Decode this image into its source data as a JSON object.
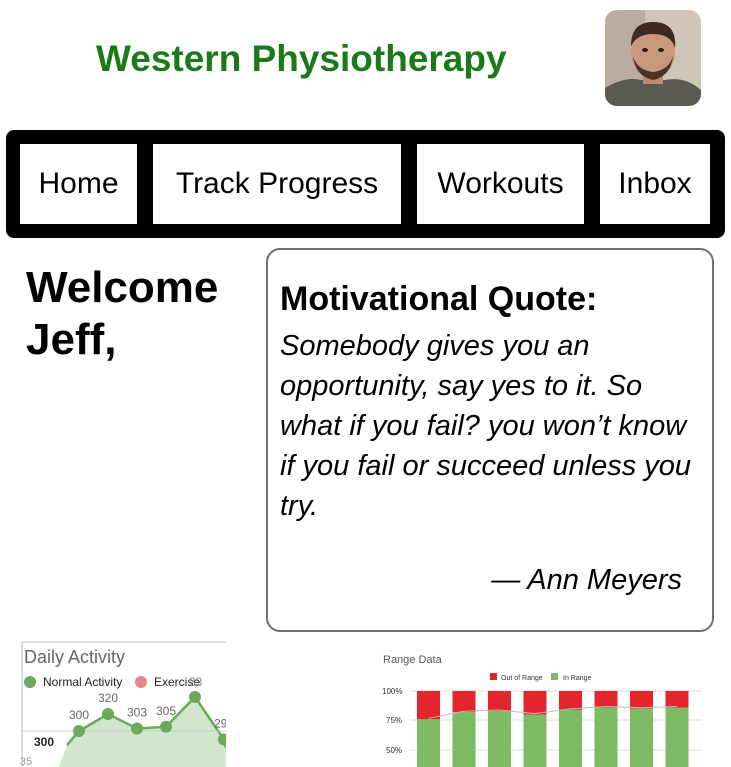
{
  "header": {
    "app_title": "Western Physiotherapy",
    "brand_color": "#1a7a1a"
  },
  "nav": {
    "items": [
      {
        "label": "Home"
      },
      {
        "label": "Track Progress"
      },
      {
        "label": "Workouts"
      },
      {
        "label": "Inbox"
      }
    ]
  },
  "welcome": {
    "line1": "Welcome",
    "line2": "Jeff,"
  },
  "quote": {
    "heading": "Motivational Quote:",
    "text": "Somebody gives you an opportunity, say yes to it. So what if you fail? you won’t know if you fail or succeed unless you try.",
    "author": "— Ann Meyers"
  },
  "chart_data": [
    {
      "type": "area",
      "title": "Daily Activity",
      "series": [
        {
          "name": "Normal Activity",
          "color": "#6aaa5a",
          "values": [
            300,
            320,
            303,
            305,
            340,
            290
          ]
        },
        {
          "name": "Exercise",
          "color": "#e08a8a",
          "values": []
        }
      ],
      "data_labels": [
        "300",
        "320",
        "303",
        "305",
        "",
        "29"
      ],
      "partial_labels": [
        "33"
      ],
      "ytick_labels": [
        "300",
        "35"
      ]
    },
    {
      "type": "bar",
      "stacked": true,
      "title": "Range Data",
      "series": [
        {
          "name": "Out of Range",
          "color": "#e3262b",
          "values": [
            24,
            18,
            17,
            20,
            16,
            14,
            15,
            14
          ]
        },
        {
          "name": "In Range",
          "color": "#7cba63",
          "values": [
            76,
            82,
            83,
            80,
            84,
            86,
            85,
            86
          ]
        }
      ],
      "ytick_labels": [
        "100%",
        "75%",
        "50%"
      ],
      "ylim": [
        0,
        100
      ]
    }
  ]
}
